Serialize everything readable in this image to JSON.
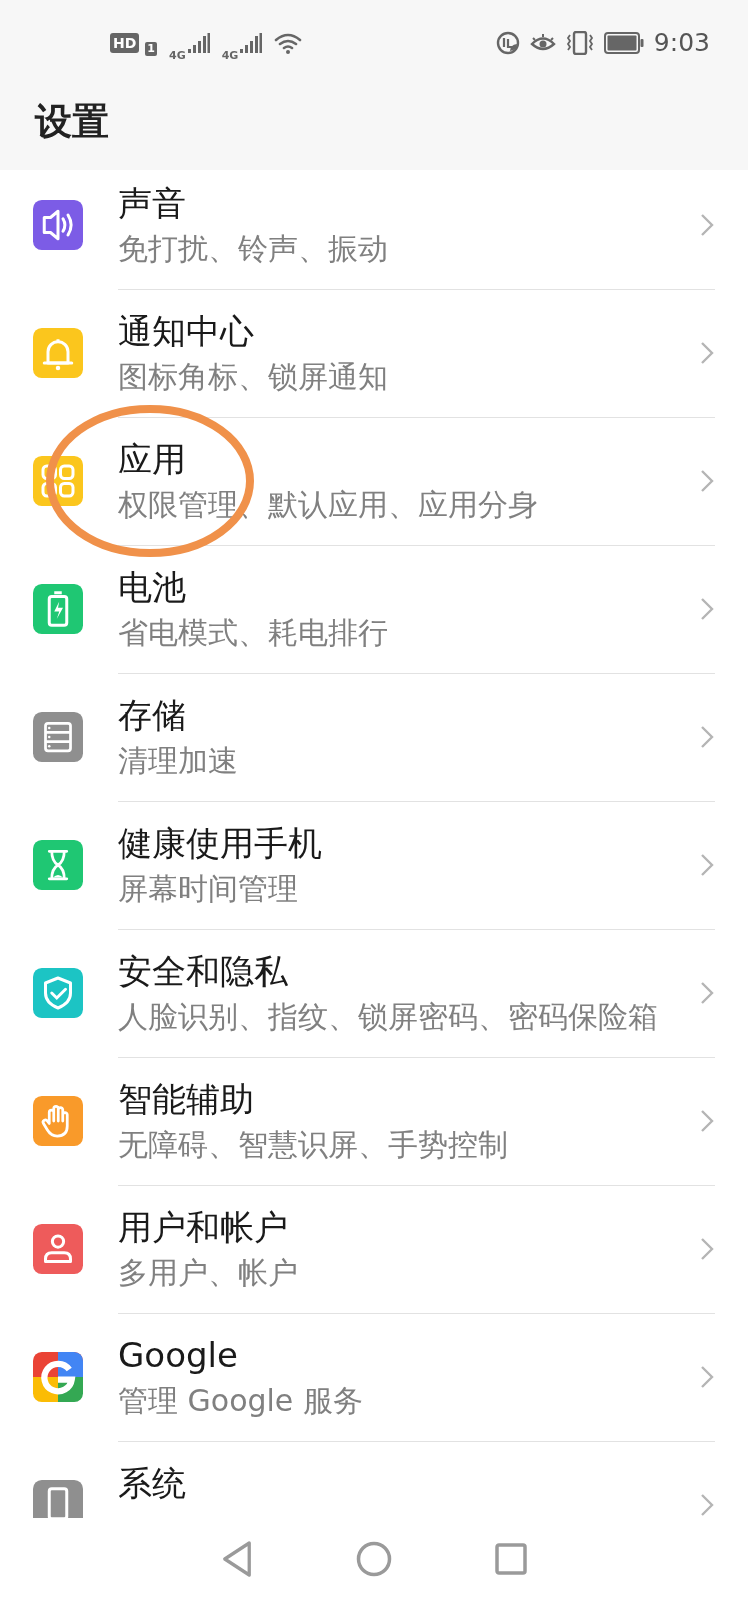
{
  "status_bar": {
    "hd_badge": "HD",
    "sim_slot": "1",
    "networks": [
      "4G",
      "4G"
    ],
    "time": "9:03"
  },
  "header": {
    "title": "设置"
  },
  "items": [
    {
      "title": "声音",
      "subtitle": "免打扰、铃声、振动",
      "color": "#7c5ce6",
      "circled": false
    },
    {
      "title": "通知中心",
      "subtitle": "图标角标、锁屏通知",
      "color": "#fbc61d",
      "circled": false
    },
    {
      "title": "应用",
      "subtitle": "权限管理、默认应用、应用分身",
      "color": "#fbc61d",
      "circled": true
    },
    {
      "title": "电池",
      "subtitle": "省电模式、耗电排行",
      "color": "#1fc773",
      "circled": false
    },
    {
      "title": "存储",
      "subtitle": "清理加速",
      "color": "#8f8f8f",
      "circled": false
    },
    {
      "title": "健康使用手机",
      "subtitle": "屏幕时间管理",
      "color": "#1fc773",
      "circled": false
    },
    {
      "title": "安全和隐私",
      "subtitle": "人脸识别、指纹、锁屏密码、密码保险箱",
      "color": "#1cc4c4",
      "circled": false
    },
    {
      "title": "智能辅助",
      "subtitle": "无障碍、智慧识屏、手势控制",
      "color": "#f99a2a",
      "circled": false
    },
    {
      "title": "用户和帐户",
      "subtitle": "多用户、帐户",
      "color": "#ee5b5b",
      "circled": false
    },
    {
      "title": "Google",
      "subtitle": "管理 Google 服务",
      "circled": false
    },
    {
      "title": "系统",
      "color": "#8f8f8f",
      "circled": false
    }
  ]
}
